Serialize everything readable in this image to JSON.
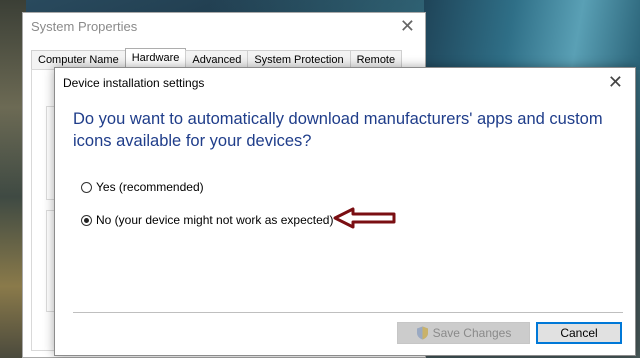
{
  "system_properties": {
    "title": "System Properties",
    "close_glyph": "✕",
    "tabs": [
      {
        "label": "Computer Name",
        "active": false
      },
      {
        "label": "Hardware",
        "active": true
      },
      {
        "label": "Advanced",
        "active": false
      },
      {
        "label": "System Protection",
        "active": false
      },
      {
        "label": "Remote",
        "active": false
      }
    ]
  },
  "dialog": {
    "title": "Device installation settings",
    "close_glyph": "✕",
    "question": "Do you want to automatically download manufacturers' apps and custom icons available for your devices?",
    "options": [
      {
        "label": "Yes (recommended)",
        "selected": false
      },
      {
        "label": "No (your device might not work as expected)",
        "selected": true
      }
    ],
    "save_button": {
      "label": "Save Changes",
      "enabled": false,
      "icon": "uac-shield-icon"
    },
    "cancel_button": {
      "label": "Cancel",
      "focused": true
    }
  },
  "annotation": {
    "arrow_color": "#7a0e12",
    "points_to": "No option"
  },
  "colors": {
    "question_text": "#1f3d8a",
    "focus_border": "#0078d7"
  }
}
